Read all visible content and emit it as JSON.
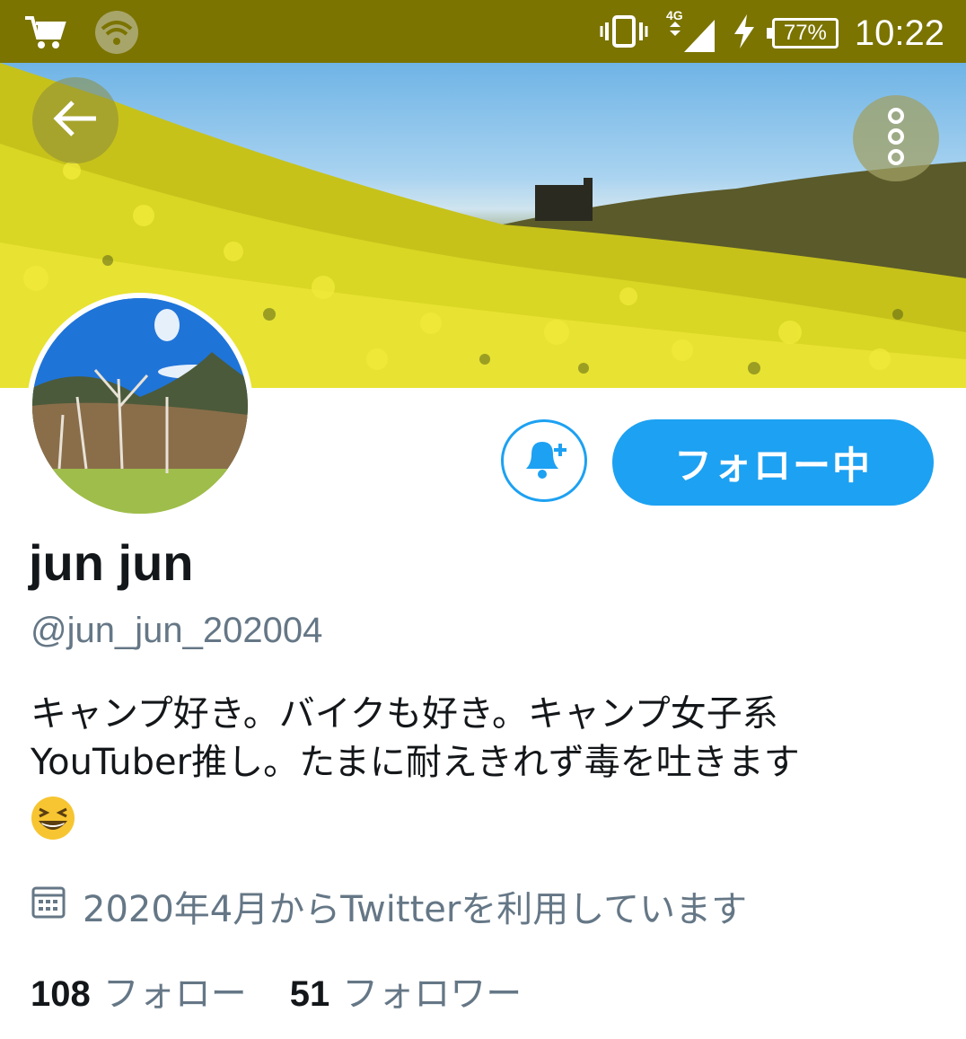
{
  "status_bar": {
    "battery": "77%",
    "time": "10:22",
    "network": "4G",
    "icons": [
      "cart-icon",
      "wifi-icon",
      "vibrate-icon",
      "signal-icon",
      "charging-icon",
      "battery-icon"
    ]
  },
  "header": {
    "back_icon": "arrow-left-icon",
    "more_icon": "more-vertical-icon"
  },
  "profile": {
    "name": "jun jun",
    "handle": "@jun_jun_202004",
    "bio_lines": [
      "キャンプ好き。バイクも好き。キャンプ女子系",
      "YouTuber推し。たまに耐えきれず毒を吐きます"
    ],
    "bio_emoji": "grinning-squinting-face-emoji",
    "joined": "2020年4月からTwitterを利用しています",
    "following_count": "108",
    "following_label": "フォロー",
    "followers_count": "51",
    "followers_label": "フォロワー"
  },
  "actions": {
    "follow_label": "フォロー中",
    "notify_icon": "bell-plus-icon"
  },
  "colors": {
    "status_bar": "#7b7400",
    "accent": "#1da1f2",
    "secondary_text": "#657786",
    "primary_text": "#14171a"
  }
}
